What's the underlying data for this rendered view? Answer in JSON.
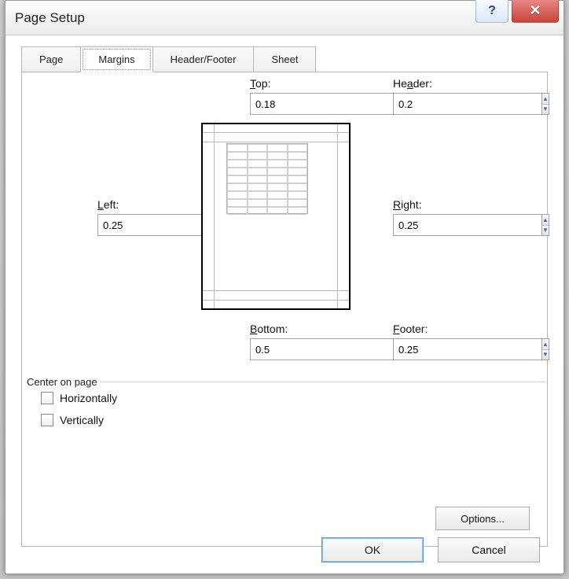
{
  "window": {
    "title": "Page Setup"
  },
  "tabs": {
    "page": "Page",
    "margins": "Margins",
    "headerfooter": "Header/Footer",
    "sheet": "Sheet",
    "active": "margins"
  },
  "margins": {
    "top": {
      "label": "Top:",
      "accel": "T",
      "value": "0.18"
    },
    "header": {
      "label": "Header:",
      "accel": "a",
      "value": "0.2"
    },
    "left": {
      "label": "Left:",
      "accel": "L",
      "value": "0.25"
    },
    "right": {
      "label": "Right:",
      "accel": "R",
      "value": "0.25"
    },
    "bottom": {
      "label": "Bottom:",
      "accel": "B",
      "value": "0.5"
    },
    "footer": {
      "label": "Footer:",
      "accel": "F",
      "value": "0.25"
    }
  },
  "center": {
    "legend": "Center on page",
    "horizontally": {
      "label": "Horizontally",
      "accel": "z",
      "checked": false
    },
    "vertically": {
      "label": "Vertically",
      "accel": "V",
      "checked": false
    }
  },
  "buttons": {
    "options": "Options...",
    "options_accel": "O",
    "ok": "OK",
    "cancel": "Cancel"
  }
}
